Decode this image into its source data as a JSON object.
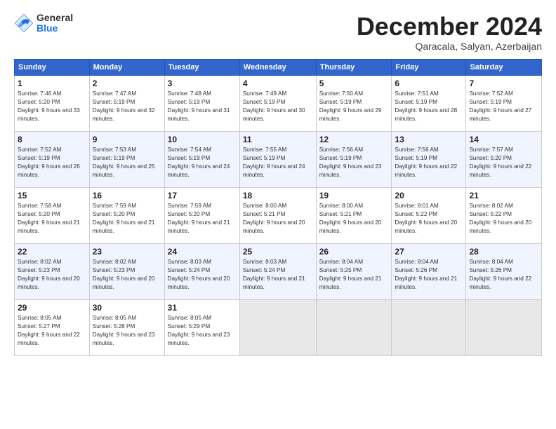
{
  "logo": {
    "general": "General",
    "blue": "Blue"
  },
  "title": "December 2024",
  "location": "Qaracala, Salyan, Azerbaijan",
  "headers": [
    "Sunday",
    "Monday",
    "Tuesday",
    "Wednesday",
    "Thursday",
    "Friday",
    "Saturday"
  ],
  "weeks": [
    [
      {
        "day": "1",
        "sunrise": "7:46 AM",
        "sunset": "5:20 PM",
        "daylight": "9 hours and 33 minutes."
      },
      {
        "day": "2",
        "sunrise": "7:47 AM",
        "sunset": "5:19 PM",
        "daylight": "9 hours and 32 minutes."
      },
      {
        "day": "3",
        "sunrise": "7:48 AM",
        "sunset": "5:19 PM",
        "daylight": "9 hours and 31 minutes."
      },
      {
        "day": "4",
        "sunrise": "7:49 AM",
        "sunset": "5:19 PM",
        "daylight": "9 hours and 30 minutes."
      },
      {
        "day": "5",
        "sunrise": "7:50 AM",
        "sunset": "5:19 PM",
        "daylight": "9 hours and 29 minutes."
      },
      {
        "day": "6",
        "sunrise": "7:51 AM",
        "sunset": "5:19 PM",
        "daylight": "9 hours and 28 minutes."
      },
      {
        "day": "7",
        "sunrise": "7:52 AM",
        "sunset": "5:19 PM",
        "daylight": "9 hours and 27 minutes."
      }
    ],
    [
      {
        "day": "8",
        "sunrise": "7:52 AM",
        "sunset": "5:19 PM",
        "daylight": "9 hours and 26 minutes."
      },
      {
        "day": "9",
        "sunrise": "7:53 AM",
        "sunset": "5:19 PM",
        "daylight": "9 hours and 25 minutes."
      },
      {
        "day": "10",
        "sunrise": "7:54 AM",
        "sunset": "5:19 PM",
        "daylight": "9 hours and 24 minutes."
      },
      {
        "day": "11",
        "sunrise": "7:55 AM",
        "sunset": "5:19 PM",
        "daylight": "9 hours and 24 minutes."
      },
      {
        "day": "12",
        "sunrise": "7:56 AM",
        "sunset": "5:19 PM",
        "daylight": "9 hours and 23 minutes."
      },
      {
        "day": "13",
        "sunrise": "7:56 AM",
        "sunset": "5:19 PM",
        "daylight": "9 hours and 22 minutes."
      },
      {
        "day": "14",
        "sunrise": "7:57 AM",
        "sunset": "5:20 PM",
        "daylight": "9 hours and 22 minutes."
      }
    ],
    [
      {
        "day": "15",
        "sunrise": "7:58 AM",
        "sunset": "5:20 PM",
        "daylight": "9 hours and 21 minutes."
      },
      {
        "day": "16",
        "sunrise": "7:59 AM",
        "sunset": "5:20 PM",
        "daylight": "9 hours and 21 minutes."
      },
      {
        "day": "17",
        "sunrise": "7:59 AM",
        "sunset": "5:20 PM",
        "daylight": "9 hours and 21 minutes."
      },
      {
        "day": "18",
        "sunrise": "8:00 AM",
        "sunset": "5:21 PM",
        "daylight": "9 hours and 20 minutes."
      },
      {
        "day": "19",
        "sunrise": "8:00 AM",
        "sunset": "5:21 PM",
        "daylight": "9 hours and 20 minutes."
      },
      {
        "day": "20",
        "sunrise": "8:01 AM",
        "sunset": "5:22 PM",
        "daylight": "9 hours and 20 minutes."
      },
      {
        "day": "21",
        "sunrise": "8:02 AM",
        "sunset": "5:22 PM",
        "daylight": "9 hours and 20 minutes."
      }
    ],
    [
      {
        "day": "22",
        "sunrise": "8:02 AM",
        "sunset": "5:23 PM",
        "daylight": "9 hours and 20 minutes."
      },
      {
        "day": "23",
        "sunrise": "8:02 AM",
        "sunset": "5:23 PM",
        "daylight": "9 hours and 20 minutes."
      },
      {
        "day": "24",
        "sunrise": "8:03 AM",
        "sunset": "5:24 PM",
        "daylight": "9 hours and 20 minutes."
      },
      {
        "day": "25",
        "sunrise": "8:03 AM",
        "sunset": "5:24 PM",
        "daylight": "9 hours and 21 minutes."
      },
      {
        "day": "26",
        "sunrise": "8:04 AM",
        "sunset": "5:25 PM",
        "daylight": "9 hours and 21 minutes."
      },
      {
        "day": "27",
        "sunrise": "8:04 AM",
        "sunset": "5:26 PM",
        "daylight": "9 hours and 21 minutes."
      },
      {
        "day": "28",
        "sunrise": "8:04 AM",
        "sunset": "5:26 PM",
        "daylight": "9 hours and 22 minutes."
      }
    ],
    [
      {
        "day": "29",
        "sunrise": "8:05 AM",
        "sunset": "5:27 PM",
        "daylight": "9 hours and 22 minutes."
      },
      {
        "day": "30",
        "sunrise": "8:05 AM",
        "sunset": "5:28 PM",
        "daylight": "9 hours and 23 minutes."
      },
      {
        "day": "31",
        "sunrise": "8:05 AM",
        "sunset": "5:29 PM",
        "daylight": "9 hours and 23 minutes."
      },
      null,
      null,
      null,
      null
    ]
  ]
}
